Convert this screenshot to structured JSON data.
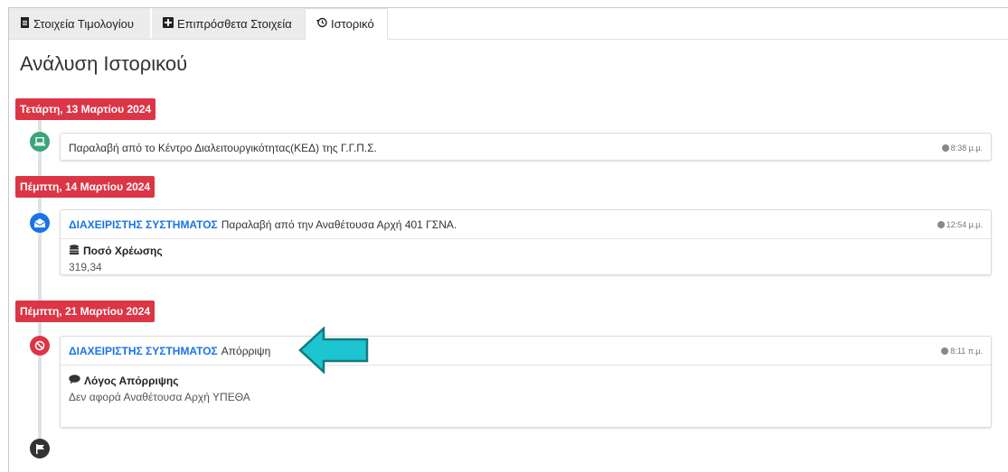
{
  "tabs": [
    {
      "icon": "file-invoice-icon",
      "label": "Στοιχεία Τιμολογίου"
    },
    {
      "icon": "plus-square-icon",
      "label": "Επιπρόσθετα Στοιχεία"
    },
    {
      "icon": "history-icon",
      "label": "Ιστορικό"
    }
  ],
  "page_title": "Ανάλυση Ιστορικού",
  "timeline": [
    {
      "date": "Τετάρτη, 13 Μαρτίου 2024",
      "icon": "laptop-icon",
      "icon_color": "#3aa57a",
      "text": "Παραλαβή από το Κέντρο Διαλειτουργικότητας(ΚΕΔ) της Γ.Γ.Π.Σ.",
      "time": "8:38 μ.μ."
    },
    {
      "date": "Πέμπτη, 14 Μαρτίου 2024",
      "icon": "envelope-open-icon",
      "icon_color": "#1a73e8",
      "user": "ΔΙΑΧΕΙΡΙΣΤΗΣ ΣΥΣΤΗΜΑΤΟΣ",
      "text": "Παραλαβή από την Αναθέτουσα Αρχή 401 ΓΣΝΑ.",
      "time": "12:54 μ.μ.",
      "detail_label": "Ποσό Χρέωσης",
      "detail_icon": "coins-icon",
      "detail_value": "319,34"
    },
    {
      "date": "Πέμπτη, 21 Μαρτίου 2024",
      "icon": "ban-icon",
      "icon_color": "#dc3545",
      "user": "ΔΙΑΧΕΙΡΙΣΤΗΣ ΣΥΣΤΗΜΑΤΟΣ",
      "text": "Απόρριψη",
      "time": "8:11 π.μ.",
      "detail_label": "Λόγος Απόρριψης",
      "detail_icon": "comment-icon",
      "detail_value": "Δεν αφορά Αναθέτουσα Αρχή ΥΠΕΘΑ"
    }
  ],
  "end_icon": "flag-icon",
  "colors": {
    "accent": "#1a73e8",
    "date_badge": "#dc3545",
    "arrow": "#1cc5d0"
  }
}
